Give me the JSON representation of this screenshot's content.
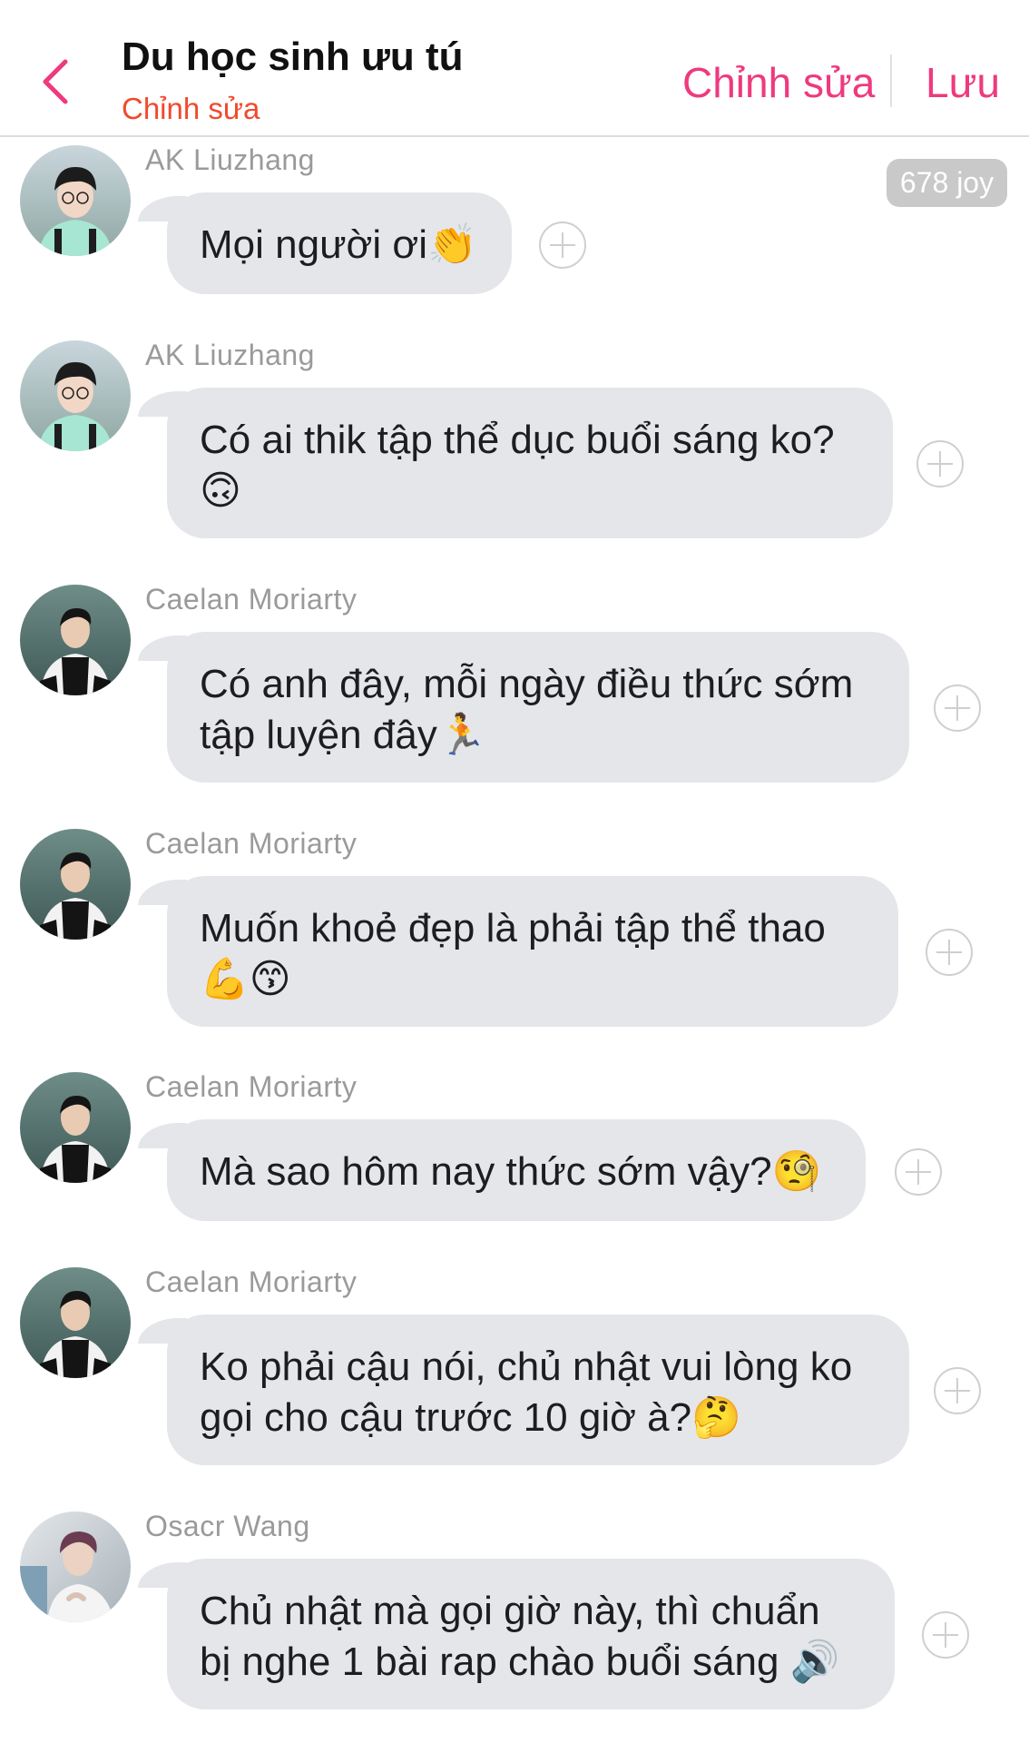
{
  "header": {
    "title": "Du học sinh ưu tú",
    "subtitle": "Chỉnh sửa",
    "edit_label": "Chỉnh sửa",
    "save_label": "Lưu",
    "accent_color": "#ee3a7f",
    "subtitle_color": "#f04a2c"
  },
  "joy_badge": "678 joy",
  "messages": [
    {
      "sender": "AK Liuzhang",
      "text": "Mọi người ơi👏",
      "avatar": "ak-liuzhang-avatar"
    },
    {
      "sender": "AK Liuzhang",
      "text": "Có ai thik tập thể dục buổi sáng ko? 🙃",
      "avatar": "ak-liuzhang-avatar"
    },
    {
      "sender": "Caelan Moriarty",
      "text": "Có anh đây, mỗi ngày điều thức sớm tập luyện đây🏃",
      "avatar": "caelan-moriarty-avatar"
    },
    {
      "sender": "Caelan Moriarty",
      "text": "Muốn khoẻ đẹp là phải tập thể thao 💪😙",
      "avatar": "caelan-moriarty-avatar"
    },
    {
      "sender": "Caelan Moriarty",
      "text": "Mà sao hôm nay thức sớm vậy?🧐",
      "avatar": "caelan-moriarty-avatar"
    },
    {
      "sender": "Caelan Moriarty",
      "text": "Ko phải cậu nói, chủ nhật vui lòng ko gọi cho cậu trước 10 giờ à?🤔",
      "avatar": "caelan-moriarty-avatar"
    },
    {
      "sender": "Osacr Wang",
      "text": "Chủ nhật mà gọi giờ này, thì chuẩn bị nghe 1 bài rap chào buổi sáng 🔊",
      "avatar": "osacr-wang-avatar"
    }
  ],
  "colors": {
    "bubble": "#e5e6ea",
    "sender_name": "#9a9a9a",
    "badge": "#c9c9c9"
  }
}
